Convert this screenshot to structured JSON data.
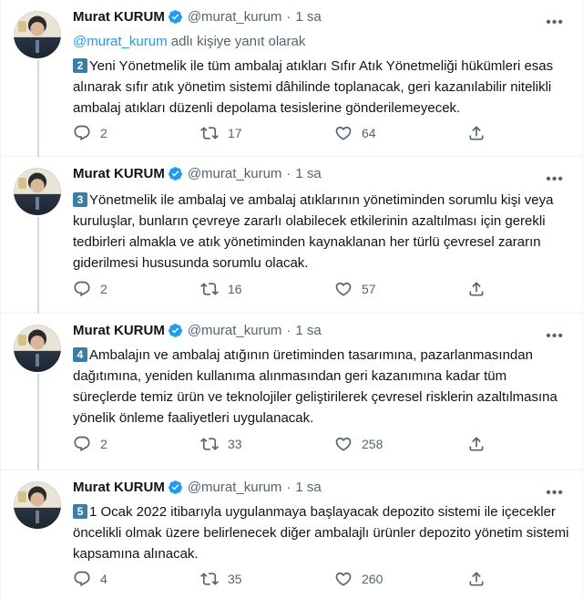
{
  "tweets": [
    {
      "name": "Murat KURUM",
      "handle": "@murat_kurum",
      "time": "1 sa",
      "reply_link": "@murat_kurum",
      "reply_text": "adlı kişiye yanıt olarak",
      "number": "2",
      "text": "Yeni Yönetmelik ile tüm ambalaj atıkları  Sıfır Atık Yönetmeliği hükümleri esas alınarak sıfır atık yönetim sistemi dâhilinde toplanacak, geri kazanılabilir nitelikli ambalaj atıkları düzenli depolama tesislerine gönderilemeyecek.",
      "replies": "2",
      "retweets": "17",
      "likes": "64"
    },
    {
      "name": "Murat KURUM",
      "handle": "@murat_kurum",
      "time": "1 sa",
      "number": "3",
      "text": "Yönetmelik ile ambalaj ve ambalaj atıklarının yönetiminden sorumlu kişi veya kuruluşlar, bunların çevreye zararlı olabilecek etkilerinin azaltılması için gerekli tedbirleri almakla ve atık yönetiminden kaynaklanan her türlü çevresel zararın giderilmesi hususunda sorumlu olacak.",
      "replies": "2",
      "retweets": "16",
      "likes": "57"
    },
    {
      "name": "Murat KURUM",
      "handle": "@murat_kurum",
      "time": "1 sa",
      "number": "4",
      "text": "Ambalajın ve ambalaj atığının üretiminden tasarımına, pazarlanmasından dağıtımına, yeniden kullanıma alınmasından geri kazanımına kadar tüm süreçlerde temiz ürün ve teknolojiler geliştirilerek çevresel risklerin azaltılmasına yönelik önleme faaliyetleri uygulanacak.",
      "replies": "2",
      "retweets": "33",
      "likes": "258"
    },
    {
      "name": "Murat KURUM",
      "handle": "@murat_kurum",
      "time": "1 sa",
      "number": "5",
      "text": "1 Ocak 2022 itibarıyla uygulanmaya başlayacak depozito sistemi ile içecekler öncelikli olmak üzere belirlenecek diğer ambalajlı ürünler depozito yönetim sistemi kapsamına alınacak.",
      "replies": "4",
      "retweets": "35",
      "likes": "260"
    }
  ],
  "icons": {
    "verified": "verified-badge-icon",
    "more": "more-options-icon",
    "reply": "reply-icon",
    "retweet": "retweet-icon",
    "like": "like-icon",
    "share": "share-icon"
  },
  "colors": {
    "link": "#1d9bf0",
    "muted": "#536471",
    "number_badge": "#3b7ea5",
    "thread_line": "#cfd9de"
  }
}
